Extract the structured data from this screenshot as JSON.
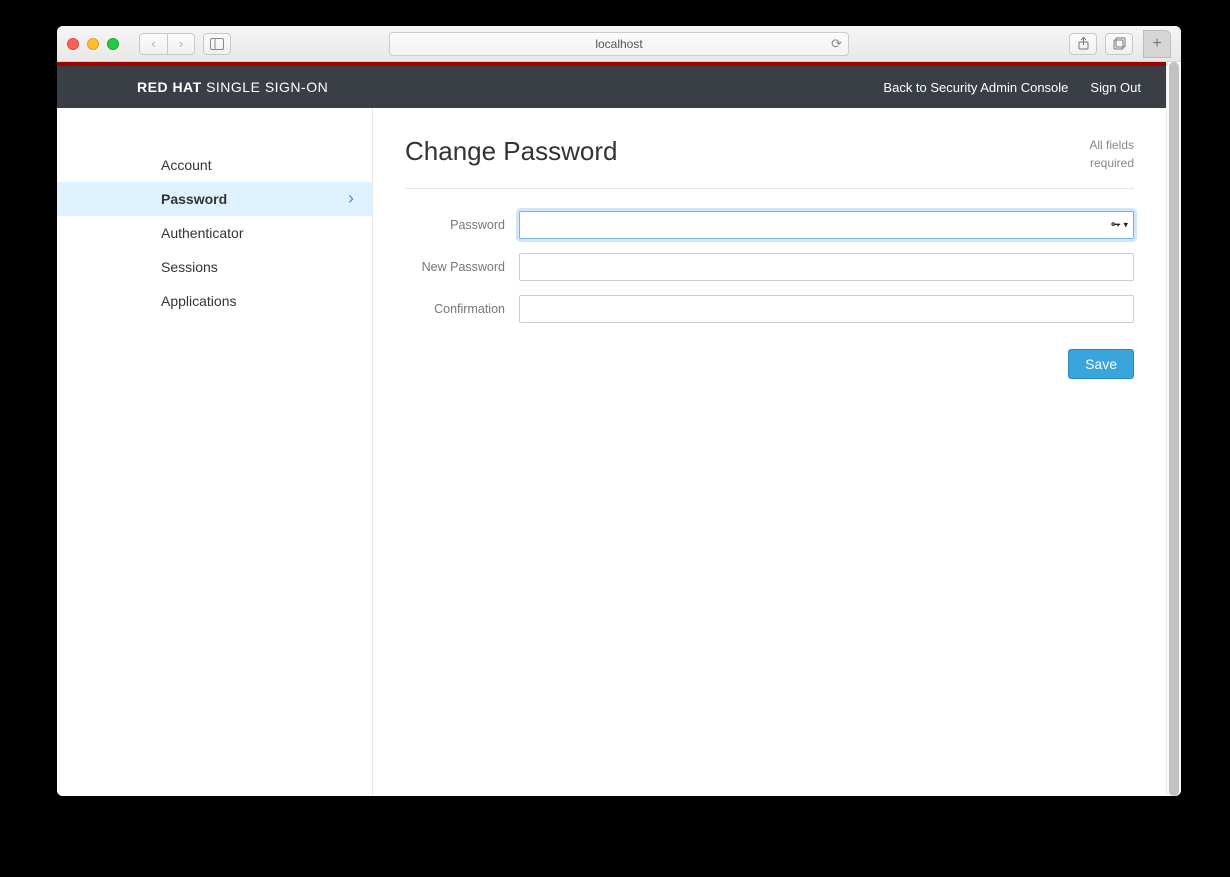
{
  "browser": {
    "url": "localhost"
  },
  "brand": {
    "bold": "RED HAT",
    "light": "SINGLE SIGN-ON"
  },
  "header_links": {
    "back": "Back to Security Admin Console",
    "signout": "Sign Out"
  },
  "sidebar": {
    "items": [
      {
        "label": "Account"
      },
      {
        "label": "Password"
      },
      {
        "label": "Authenticator"
      },
      {
        "label": "Sessions"
      },
      {
        "label": "Applications"
      }
    ],
    "active_index": 1
  },
  "main": {
    "title": "Change Password",
    "required_note_line1": "All fields",
    "required_note_line2": "required",
    "fields": {
      "password_label": "Password",
      "new_password_label": "New Password",
      "confirmation_label": "Confirmation"
    },
    "save_label": "Save"
  }
}
